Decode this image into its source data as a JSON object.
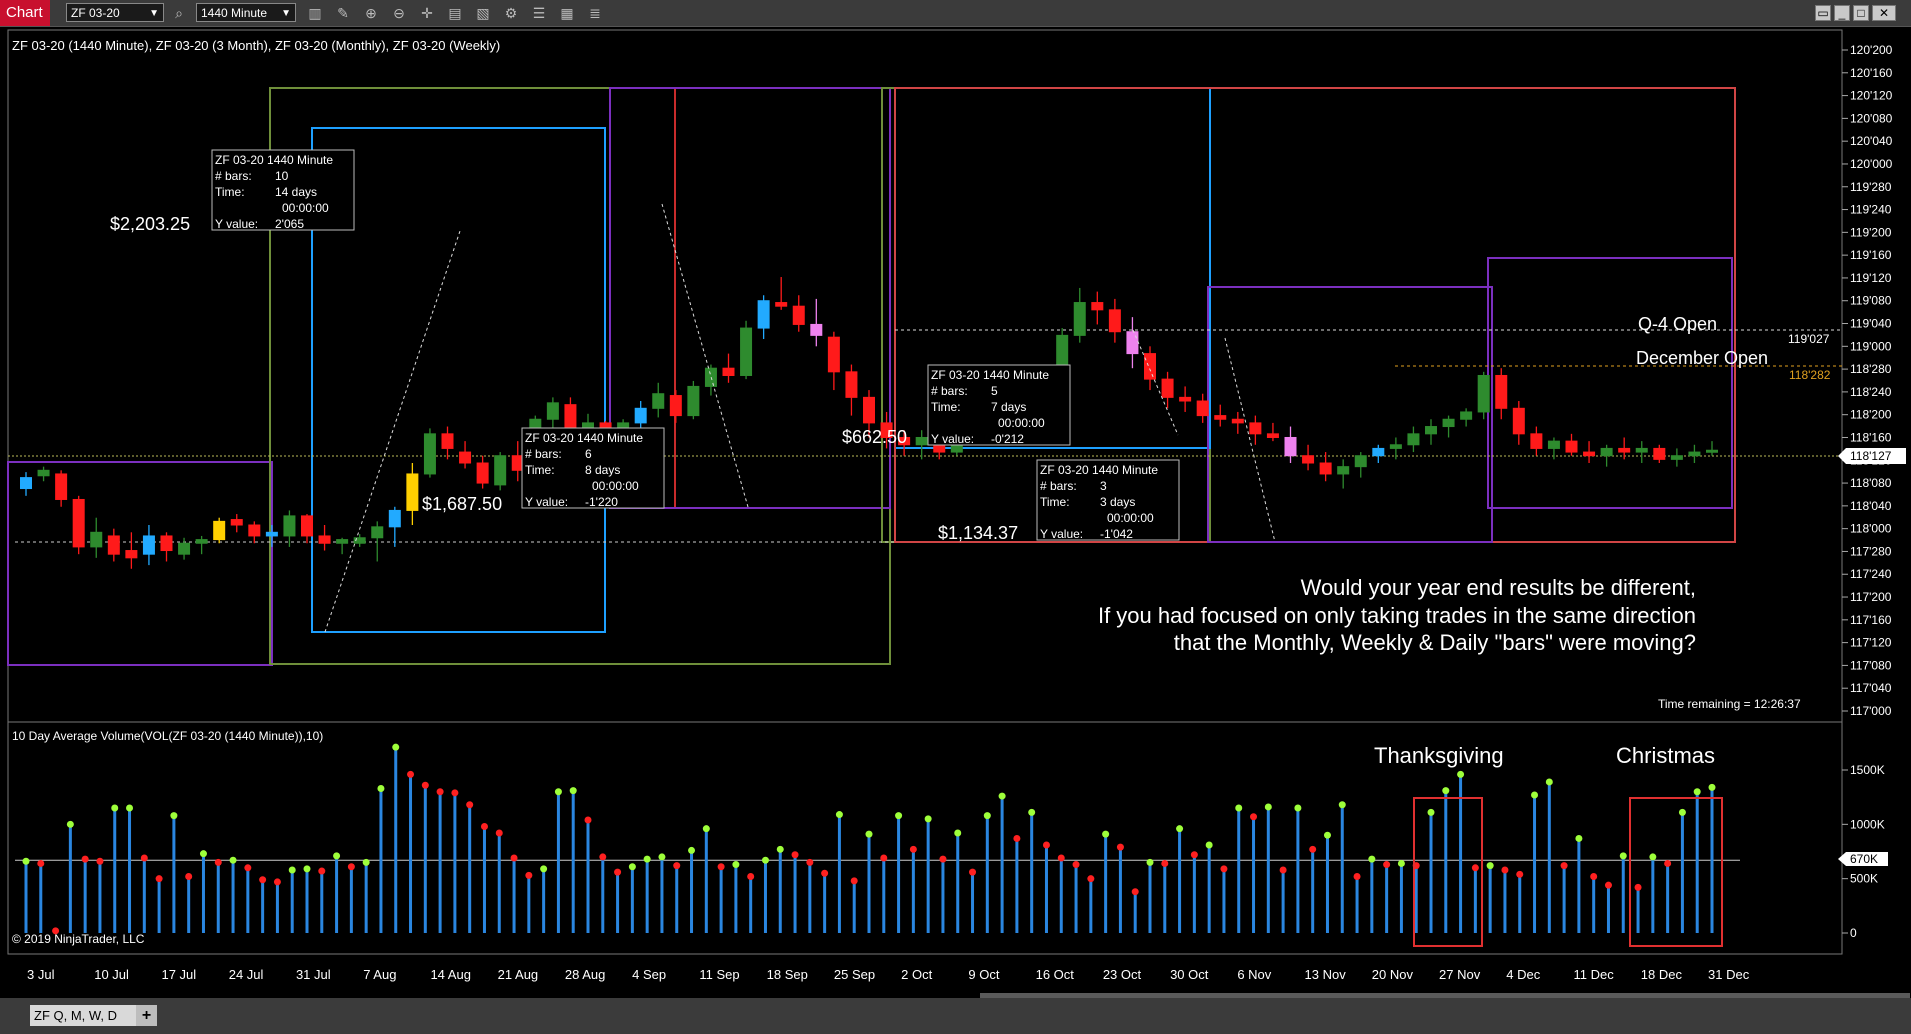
{
  "toolbar": {
    "chart_label": "Chart",
    "instrument": "ZF 03-20",
    "interval": "1440 Minute",
    "icons": [
      "search-icon",
      "bar-style-icon",
      "draw-icon",
      "zoom-in-icon",
      "zoom-out-icon",
      "crosshair-icon",
      "data-box-icon",
      "indicators-icon",
      "strategies-icon",
      "properties-icon"
    ]
  },
  "chart": {
    "title": "ZF 03-20 (1440 Minute), ZF 03-20 (3 Month), ZF 03-20 (Monthly), ZF 03-20 (Weekly)",
    "volume_title": "10 Day Average Volume(VOL(ZF 03-20 (1440 Minute)),10)",
    "copyright": "© 2019 NinjaTrader, LLC",
    "time_remaining": "Time remaining = 12:26:37",
    "price_labels": [
      "120'200",
      "120'160",
      "120'120",
      "120'080",
      "120'040",
      "120'000",
      "119'280",
      "119'240",
      "119'200",
      "119'160",
      "119'120",
      "119'080",
      "119'040",
      "119'000",
      "118'280",
      "118'240",
      "118'200",
      "118'160",
      "118'120",
      "118'080",
      "118'040",
      "118'000",
      "117'280",
      "117'240",
      "117'200",
      "117'160",
      "117'120",
      "117'080",
      "117'040",
      "117'000"
    ],
    "current_price": "118'127",
    "q4_value": "119'027",
    "dec_value": "118'282",
    "volume_labels": [
      "1500K",
      "1000K",
      "500K",
      "0"
    ],
    "volume_current": "670K",
    "date_labels": [
      "3 Jul",
      "10 Jul",
      "17 Jul",
      "24 Jul",
      "31 Jul",
      "7 Aug",
      "14 Aug",
      "21 Aug",
      "28 Aug",
      "4 Sep",
      "11 Sep",
      "18 Sep",
      "25 Sep",
      "2 Oct",
      "9 Oct",
      "16 Oct",
      "23 Oct",
      "30 Oct",
      "6 Nov",
      "13 Nov",
      "20 Nov",
      "27 Nov",
      "4 Dec",
      "11 Dec",
      "18 Dec",
      "31 Dec"
    ],
    "q4_open_label": "Q-4 Open",
    "december_open_label": "December Open",
    "dollar_labels": [
      "$2,203.25",
      "$1,687.50",
      "$662.50",
      "$1,134.37"
    ],
    "annotation_lines": [
      "Would your year end results be different,",
      "If you had focused on only taking trades in the same direction",
      "that the Monthly, Weekly &  Daily \"bars\" were moving?"
    ],
    "event_labels": [
      "Thanksgiving",
      "Christmas"
    ],
    "info_boxes": [
      {
        "title": "ZF 03-20 1440 Minute",
        "bars_label": "# bars:",
        "bars": "10",
        "time_label": "Time:",
        "time": "14 days",
        "time2": "00:00:00",
        "yv_label": "Y value:",
        "yv": "2'065"
      },
      {
        "title": "ZF 03-20 1440 Minute",
        "bars_label": "# bars:",
        "bars": "6",
        "time_label": "Time:",
        "time": "8 days",
        "time2": "00:00:00",
        "yv_label": "Y value:",
        "yv": "-1'220"
      },
      {
        "title": "ZF 03-20 1440 Minute",
        "bars_label": "# bars:",
        "bars": "5",
        "time_label": "Time:",
        "time": "7 days",
        "time2": "00:00:00",
        "yv_label": "Y value:",
        "yv": "-0'212"
      },
      {
        "title": "ZF 03-20 1440 Minute",
        "bars_label": "# bars:",
        "bars": "3",
        "time_label": "Time:",
        "time": "3 days",
        "time2": "00:00:00",
        "yv_label": "Y value:",
        "yv": "-1'042"
      }
    ]
  },
  "chart_data": {
    "type": "candlestick",
    "instrument": "ZF 03-20",
    "price_format": "points'32nds-tenths (e.g. 118'127 = 118 + 12.7/32)",
    "y_range": [
      "117'000",
      "120'200"
    ],
    "candles": [
      [
        118.22,
        118.31,
        118.18,
        118.28
      ],
      [
        118.29,
        118.34,
        118.26,
        118.32
      ],
      [
        118.3,
        118.32,
        118.12,
        118.16
      ],
      [
        118.16,
        118.18,
        117.86,
        117.9
      ],
      [
        117.9,
        118.06,
        117.84,
        117.98
      ],
      [
        117.96,
        118.0,
        117.82,
        117.86
      ],
      [
        117.88,
        117.98,
        117.78,
        117.84
      ],
      [
        117.86,
        118.02,
        117.8,
        117.96
      ],
      [
        117.96,
        117.98,
        117.82,
        117.88
      ],
      [
        117.86,
        117.95,
        117.83,
        117.92
      ],
      [
        117.92,
        117.96,
        117.86,
        117.94
      ],
      [
        117.94,
        118.06,
        117.92,
        118.04
      ],
      [
        118.05,
        118.08,
        117.98,
        118.02
      ],
      [
        118.02,
        118.04,
        117.92,
        117.96
      ],
      [
        117.96,
        118.02,
        117.9,
        117.98
      ],
      [
        117.96,
        118.1,
        117.9,
        118.07
      ],
      [
        118.07,
        118.08,
        117.92,
        117.96
      ],
      [
        117.96,
        118.02,
        117.88,
        117.92
      ],
      [
        117.92,
        117.95,
        117.86,
        117.94
      ],
      [
        117.92,
        117.97,
        117.9,
        117.95
      ],
      [
        117.95,
        118.04,
        117.82,
        118.01
      ],
      [
        118.01,
        118.12,
        117.9,
        118.1
      ],
      [
        118.1,
        118.36,
        118.02,
        118.3
      ],
      [
        118.3,
        118.55,
        118.28,
        118.52
      ],
      [
        118.52,
        118.56,
        118.38,
        118.44
      ],
      [
        118.42,
        118.48,
        118.33,
        118.36
      ],
      [
        118.36,
        118.4,
        118.22,
        118.25
      ],
      [
        118.24,
        118.42,
        118.21,
        118.4
      ],
      [
        118.4,
        118.48,
        118.26,
        118.32
      ],
      [
        118.33,
        118.62,
        118.29,
        118.6
      ],
      [
        118.6,
        118.72,
        118.55,
        118.69
      ],
      [
        118.68,
        118.72,
        118.52,
        118.55
      ],
      [
        118.55,
        118.63,
        118.45,
        118.58
      ],
      [
        118.58,
        118.59,
        118.43,
        118.45
      ],
      [
        118.46,
        118.6,
        118.42,
        118.58
      ],
      [
        118.58,
        118.7,
        118.54,
        118.66
      ],
      [
        118.66,
        118.8,
        118.61,
        118.74
      ],
      [
        118.73,
        118.76,
        118.58,
        118.62
      ],
      [
        118.62,
        118.81,
        118.6,
        118.78
      ],
      [
        118.78,
        118.9,
        118.73,
        118.88
      ],
      [
        118.88,
        118.96,
        118.8,
        118.84
      ],
      [
        118.84,
        119.14,
        118.82,
        119.1
      ],
      [
        119.1,
        119.28,
        119.04,
        119.25
      ],
      [
        119.24,
        119.38,
        119.2,
        119.22
      ],
      [
        119.22,
        119.28,
        119.08,
        119.12
      ],
      [
        119.12,
        119.26,
        119.0,
        119.06
      ],
      [
        119.05,
        119.08,
        118.76,
        118.86
      ],
      [
        118.86,
        118.9,
        118.62,
        118.72
      ],
      [
        118.72,
        118.76,
        118.5,
        118.58
      ],
      [
        118.58,
        118.64,
        118.44,
        118.5
      ],
      [
        118.5,
        118.54,
        118.4,
        118.46
      ],
      [
        118.46,
        118.54,
        118.38,
        118.5
      ],
      [
        118.5,
        118.54,
        118.38,
        118.42
      ],
      [
        118.42,
        118.6,
        118.4,
        118.58
      ],
      [
        118.58,
        118.72,
        118.56,
        118.7
      ],
      [
        118.7,
        118.74,
        118.54,
        118.6
      ],
      [
        118.6,
        118.78,
        118.58,
        118.74
      ],
      [
        118.74,
        118.82,
        118.66,
        118.78
      ],
      [
        118.78,
        118.88,
        118.7,
        118.84
      ],
      [
        118.84,
        119.1,
        118.82,
        119.06
      ],
      [
        119.06,
        119.32,
        119.02,
        119.24
      ],
      [
        119.24,
        119.3,
        119.12,
        119.2
      ],
      [
        119.2,
        119.26,
        119.02,
        119.08
      ],
      [
        119.08,
        119.16,
        118.88,
        118.96
      ],
      [
        118.96,
        119.0,
        118.76,
        118.82
      ],
      [
        118.82,
        118.86,
        118.66,
        118.72
      ],
      [
        118.72,
        118.78,
        118.64,
        118.7
      ],
      [
        118.7,
        118.74,
        118.58,
        118.62
      ],
      [
        118.62,
        118.68,
        118.56,
        118.6
      ],
      [
        118.6,
        118.64,
        118.52,
        118.58
      ],
      [
        118.58,
        118.62,
        118.46,
        118.52
      ],
      [
        118.52,
        118.58,
        118.48,
        118.5
      ],
      [
        118.5,
        118.56,
        118.36,
        118.4
      ],
      [
        118.4,
        118.46,
        118.32,
        118.36
      ],
      [
        118.36,
        118.42,
        118.26,
        118.3
      ],
      [
        118.3,
        118.38,
        118.22,
        118.34
      ],
      [
        118.34,
        118.42,
        118.28,
        118.4
      ],
      [
        118.4,
        118.46,
        118.36,
        118.44
      ],
      [
        118.44,
        118.5,
        118.38,
        118.46
      ],
      [
        118.46,
        118.56,
        118.42,
        118.52
      ],
      [
        118.52,
        118.6,
        118.46,
        118.56
      ],
      [
        118.56,
        118.62,
        118.5,
        118.6
      ],
      [
        118.6,
        118.66,
        118.56,
        118.64
      ],
      [
        118.64,
        118.86,
        118.6,
        118.84
      ],
      [
        118.84,
        118.88,
        118.6,
        118.66
      ],
      [
        118.66,
        118.7,
        118.46,
        118.52
      ],
      [
        118.52,
        118.56,
        118.4,
        118.44
      ],
      [
        118.44,
        118.5,
        118.38,
        118.48
      ],
      [
        118.48,
        118.52,
        118.4,
        118.42
      ],
      [
        118.42,
        118.48,
        118.36,
        118.4
      ],
      [
        118.4,
        118.46,
        118.34,
        118.44
      ],
      [
        118.44,
        118.5,
        118.38,
        118.42
      ],
      [
        118.42,
        118.48,
        118.36,
        118.44
      ],
      [
        118.44,
        118.46,
        118.36,
        118.38
      ],
      [
        118.38,
        118.44,
        118.34,
        118.4
      ],
      [
        118.4,
        118.46,
        118.36,
        118.42
      ],
      [
        118.42,
        118.48,
        118.4,
        118.43
      ]
    ],
    "volume": [
      660,
      640,
      20,
      1000,
      680,
      660,
      1150,
      1150,
      690,
      500,
      1080,
      520,
      730,
      650,
      670,
      600,
      490,
      470,
      580,
      590,
      570,
      710,
      610,
      650,
      1330,
      1710,
      1460,
      1360,
      1300,
      1290,
      1180,
      980,
      920,
      690,
      530,
      590,
      1300,
      1310,
      1040,
      700,
      560,
      610,
      680,
      700,
      620,
      760,
      960,
      610,
      630,
      520,
      670,
      770,
      720,
      650,
      550,
      1090,
      480,
      910,
      690,
      1080,
      770,
      1050,
      680,
      920,
      560,
      1080,
      1260,
      870,
      1110,
      810,
      690,
      630,
      500,
      910,
      790,
      380,
      650,
      640,
      960,
      720,
      810,
      590,
      1150,
      1070,
      1160,
      580,
      1150,
      770,
      900,
      1180,
      520,
      680,
      630,
      640,
      620,
      1110,
      1310,
      1460,
      600,
      620,
      580,
      540,
      1270,
      1390,
      620,
      870,
      520,
      440,
      710,
      420,
      700,
      640,
      1110,
      1300,
      1340
    ],
    "volume_price_line": 670,
    "weekly_candle_ranges": "Derived from daily candles grouped by week"
  }
}
